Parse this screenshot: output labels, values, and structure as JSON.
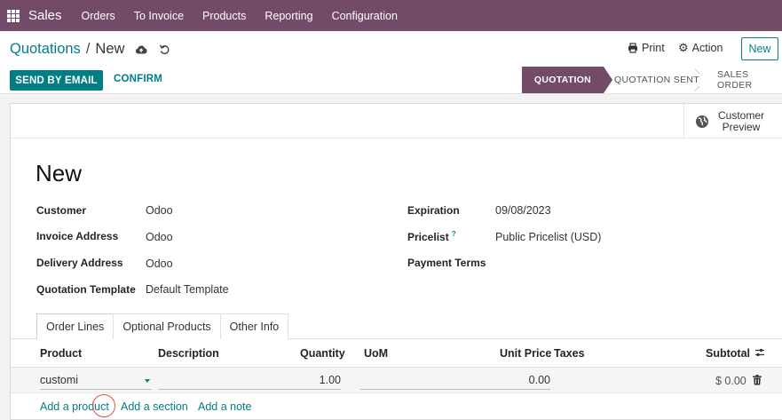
{
  "nav": {
    "app": "Sales",
    "menu": [
      "Orders",
      "To Invoice",
      "Products",
      "Reporting",
      "Configuration"
    ]
  },
  "breadcrumb": {
    "parent": "Quotations",
    "separator": "/",
    "current": "New"
  },
  "toolbar": {
    "print": "Print",
    "action": "Action",
    "new": "New"
  },
  "buttons": {
    "send_email": "SEND BY EMAIL",
    "confirm": "CONFIRM"
  },
  "status": [
    "QUOTATION",
    "QUOTATION SENT",
    "SALES ORDER"
  ],
  "preview": {
    "line1": "Customer",
    "line2": "Preview"
  },
  "record": {
    "title": "New"
  },
  "fields": {
    "customer": {
      "label": "Customer",
      "value": "Odoo"
    },
    "invoice_address": {
      "label": "Invoice Address",
      "value": "Odoo"
    },
    "delivery_address": {
      "label": "Delivery Address",
      "value": "Odoo"
    },
    "quotation_template": {
      "label": "Quotation Template",
      "value": "Default Template"
    },
    "expiration": {
      "label": "Expiration",
      "value": "09/08/2023"
    },
    "pricelist": {
      "label": "Pricelist",
      "help": "?",
      "value": "Public Pricelist (USD)"
    },
    "payment_terms": {
      "label": "Payment Terms",
      "value": ""
    }
  },
  "tabs": [
    "Order Lines",
    "Optional Products",
    "Other Info"
  ],
  "table": {
    "headers": {
      "product": "Product",
      "description": "Description",
      "quantity": "Quantity",
      "uom": "UoM",
      "unit_price": "Unit Price",
      "taxes": "Taxes",
      "subtotal": "Subtotal"
    },
    "row": {
      "product": "customi",
      "quantity": "1.00",
      "unit_price": "0.00",
      "subtotal": "$ 0.00"
    },
    "add_links": [
      "Add a product",
      "Add a section",
      "Add a note"
    ]
  },
  "colors": {
    "brand": "#714b67",
    "accent": "#017e84"
  },
  "icons": [
    "apps-grid-icon",
    "cloud-upload-icon",
    "undo-icon",
    "printer-icon",
    "gear-icon",
    "globe-icon",
    "help-icon",
    "caret-down-icon",
    "trash-icon",
    "adjust-columns-icon"
  ]
}
